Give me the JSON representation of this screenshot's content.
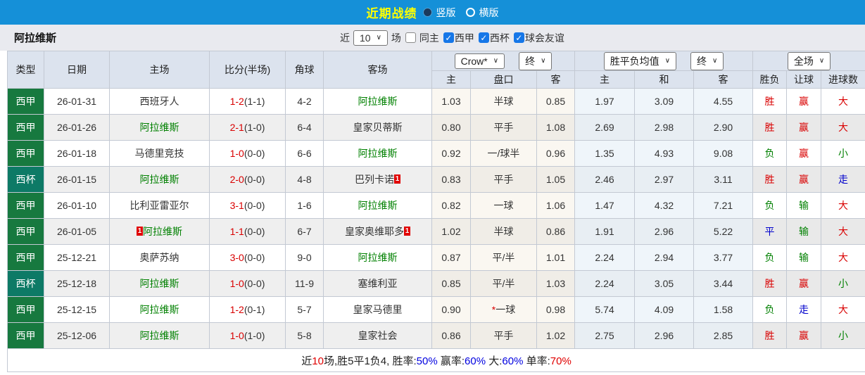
{
  "topbar": {
    "title": "近期战绩",
    "layout_options": [
      {
        "label": "竖版",
        "selected": true
      },
      {
        "label": "横版",
        "selected": false
      }
    ]
  },
  "filterbar": {
    "team_name": "阿拉维斯",
    "near_label": "近",
    "match_count": "10",
    "games_label": "场",
    "filters": [
      {
        "label": "同主",
        "checked": false
      },
      {
        "label": "西甲",
        "checked": true
      },
      {
        "label": "西杯",
        "checked": true
      },
      {
        "label": "球会友谊",
        "checked": true
      }
    ]
  },
  "table": {
    "col_headers": {
      "type": "类型",
      "date": "日期",
      "home": "主场",
      "score": "比分(半场)",
      "corner": "角球",
      "away": "客场"
    },
    "selectors": {
      "odds_company": "Crow*",
      "odds_time": "终",
      "avg_label": "胜平负均值",
      "avg_time": "终",
      "full_match": "全场"
    },
    "sub_headers": [
      "主",
      "盘口",
      "客",
      "主",
      "和",
      "客",
      "胜负",
      "让球",
      "进球数"
    ],
    "league_colors": {
      "西甲": "#17793f",
      "西杯": "#0d7a66"
    },
    "result_colors": {
      "胜": "#d90000",
      "负": "#008000",
      "平": "#0000cc",
      "赢": "#d90000",
      "输": "#008000",
      "走": "#0000cc",
      "大": "#d90000",
      "小": "#008000"
    },
    "rows": [
      {
        "league": "西甲",
        "date": "26-01-31",
        "home": {
          "name": "西班牙人",
          "green": false,
          "badge": ""
        },
        "score_ft": "1-2",
        "score_ht": "(1-1)",
        "corner": "4-2",
        "away": {
          "name": "阿拉维斯",
          "green": true,
          "badge": ""
        },
        "crow": [
          "1.03",
          "半球",
          "0.85"
        ],
        "handicap_star": false,
        "avg": [
          "1.97",
          "3.09",
          "4.55"
        ],
        "result": [
          "胜",
          "赢",
          "大"
        ]
      },
      {
        "league": "西甲",
        "date": "26-01-26",
        "home": {
          "name": "阿拉维斯",
          "green": true,
          "badge": ""
        },
        "score_ft": "2-1",
        "score_ht": "(1-0)",
        "corner": "6-4",
        "away": {
          "name": "皇家贝蒂斯",
          "green": false,
          "badge": ""
        },
        "crow": [
          "0.80",
          "平手",
          "1.08"
        ],
        "handicap_star": false,
        "avg": [
          "2.69",
          "2.98",
          "2.90"
        ],
        "result": [
          "胜",
          "赢",
          "大"
        ]
      },
      {
        "league": "西甲",
        "date": "26-01-18",
        "home": {
          "name": "马德里竞技",
          "green": false,
          "badge": ""
        },
        "score_ft": "1-0",
        "score_ht": "(0-0)",
        "corner": "6-6",
        "away": {
          "name": "阿拉维斯",
          "green": true,
          "badge": ""
        },
        "crow": [
          "0.92",
          "一/球半",
          "0.96"
        ],
        "handicap_star": false,
        "avg": [
          "1.35",
          "4.93",
          "9.08"
        ],
        "result": [
          "负",
          "赢",
          "小"
        ]
      },
      {
        "league": "西杯",
        "date": "26-01-15",
        "home": {
          "name": "阿拉维斯",
          "green": true,
          "badge": ""
        },
        "score_ft": "2-0",
        "score_ht": "(0-0)",
        "corner": "4-8",
        "away": {
          "name": "巴列卡诺",
          "green": false,
          "badge": "1"
        },
        "crow": [
          "0.83",
          "平手",
          "1.05"
        ],
        "handicap_star": false,
        "avg": [
          "2.46",
          "2.97",
          "3.11"
        ],
        "result": [
          "胜",
          "赢",
          "走"
        ]
      },
      {
        "league": "西甲",
        "date": "26-01-10",
        "home": {
          "name": "比利亚雷亚尔",
          "green": false,
          "badge": ""
        },
        "score_ft": "3-1",
        "score_ht": "(0-0)",
        "corner": "1-6",
        "away": {
          "name": "阿拉维斯",
          "green": true,
          "badge": ""
        },
        "crow": [
          "0.82",
          "一球",
          "1.06"
        ],
        "handicap_star": false,
        "avg": [
          "1.47",
          "4.32",
          "7.21"
        ],
        "result": [
          "负",
          "输",
          "大"
        ]
      },
      {
        "league": "西甲",
        "date": "26-01-05",
        "home": {
          "name": "阿拉维斯",
          "green": true,
          "badge": "1"
        },
        "score_ft": "1-1",
        "score_ht": "(0-0)",
        "corner": "6-7",
        "away": {
          "name": "皇家奥维耶多",
          "green": false,
          "badge": "1"
        },
        "crow": [
          "1.02",
          "半球",
          "0.86"
        ],
        "handicap_star": false,
        "avg": [
          "1.91",
          "2.96",
          "5.22"
        ],
        "result": [
          "平",
          "输",
          "大"
        ]
      },
      {
        "league": "西甲",
        "date": "25-12-21",
        "home": {
          "name": "奥萨苏纳",
          "green": false,
          "badge": ""
        },
        "score_ft": "3-0",
        "score_ht": "(0-0)",
        "corner": "9-0",
        "away": {
          "name": "阿拉维斯",
          "green": true,
          "badge": ""
        },
        "crow": [
          "0.87",
          "平/半",
          "1.01"
        ],
        "handicap_star": false,
        "avg": [
          "2.24",
          "2.94",
          "3.77"
        ],
        "result": [
          "负",
          "输",
          "大"
        ]
      },
      {
        "league": "西杯",
        "date": "25-12-18",
        "home": {
          "name": "阿拉维斯",
          "green": true,
          "badge": ""
        },
        "score_ft": "1-0",
        "score_ht": "(0-0)",
        "corner": "11-9",
        "away": {
          "name": "塞维利亚",
          "green": false,
          "badge": ""
        },
        "crow": [
          "0.85",
          "平/半",
          "1.03"
        ],
        "handicap_star": false,
        "avg": [
          "2.24",
          "3.05",
          "3.44"
        ],
        "result": [
          "胜",
          "赢",
          "小"
        ]
      },
      {
        "league": "西甲",
        "date": "25-12-15",
        "home": {
          "name": "阿拉维斯",
          "green": true,
          "badge": ""
        },
        "score_ft": "1-2",
        "score_ht": "(0-1)",
        "corner": "5-7",
        "away": {
          "name": "皇家马德里",
          "green": false,
          "badge": ""
        },
        "crow": [
          "0.90",
          "一球",
          "0.98"
        ],
        "handicap_star": true,
        "avg": [
          "5.74",
          "4.09",
          "1.58"
        ],
        "result": [
          "负",
          "走",
          "大"
        ]
      },
      {
        "league": "西甲",
        "date": "25-12-06",
        "home": {
          "name": "阿拉维斯",
          "green": true,
          "badge": ""
        },
        "score_ft": "1-0",
        "score_ht": "(1-0)",
        "corner": "5-8",
        "away": {
          "name": "皇家社会",
          "green": false,
          "badge": ""
        },
        "crow": [
          "0.86",
          "平手",
          "1.02"
        ],
        "handicap_star": false,
        "avg": [
          "2.75",
          "2.96",
          "2.85"
        ],
        "result": [
          "胜",
          "赢",
          "小"
        ]
      }
    ]
  },
  "footer": {
    "segments": [
      {
        "text": "近",
        "color": "black"
      },
      {
        "text": "10",
        "color": "red"
      },
      {
        "text": "场,胜5平1负4, 胜率:",
        "color": "black"
      },
      {
        "text": "50%",
        "color": "blue"
      },
      {
        "text": " 赢率:",
        "color": "black"
      },
      {
        "text": "60%",
        "color": "blue"
      },
      {
        "text": " 大:",
        "color": "black"
      },
      {
        "text": "60%",
        "color": "blue"
      },
      {
        "text": " 单率:",
        "color": "black"
      },
      {
        "text": "70%",
        "color": "red"
      }
    ]
  }
}
